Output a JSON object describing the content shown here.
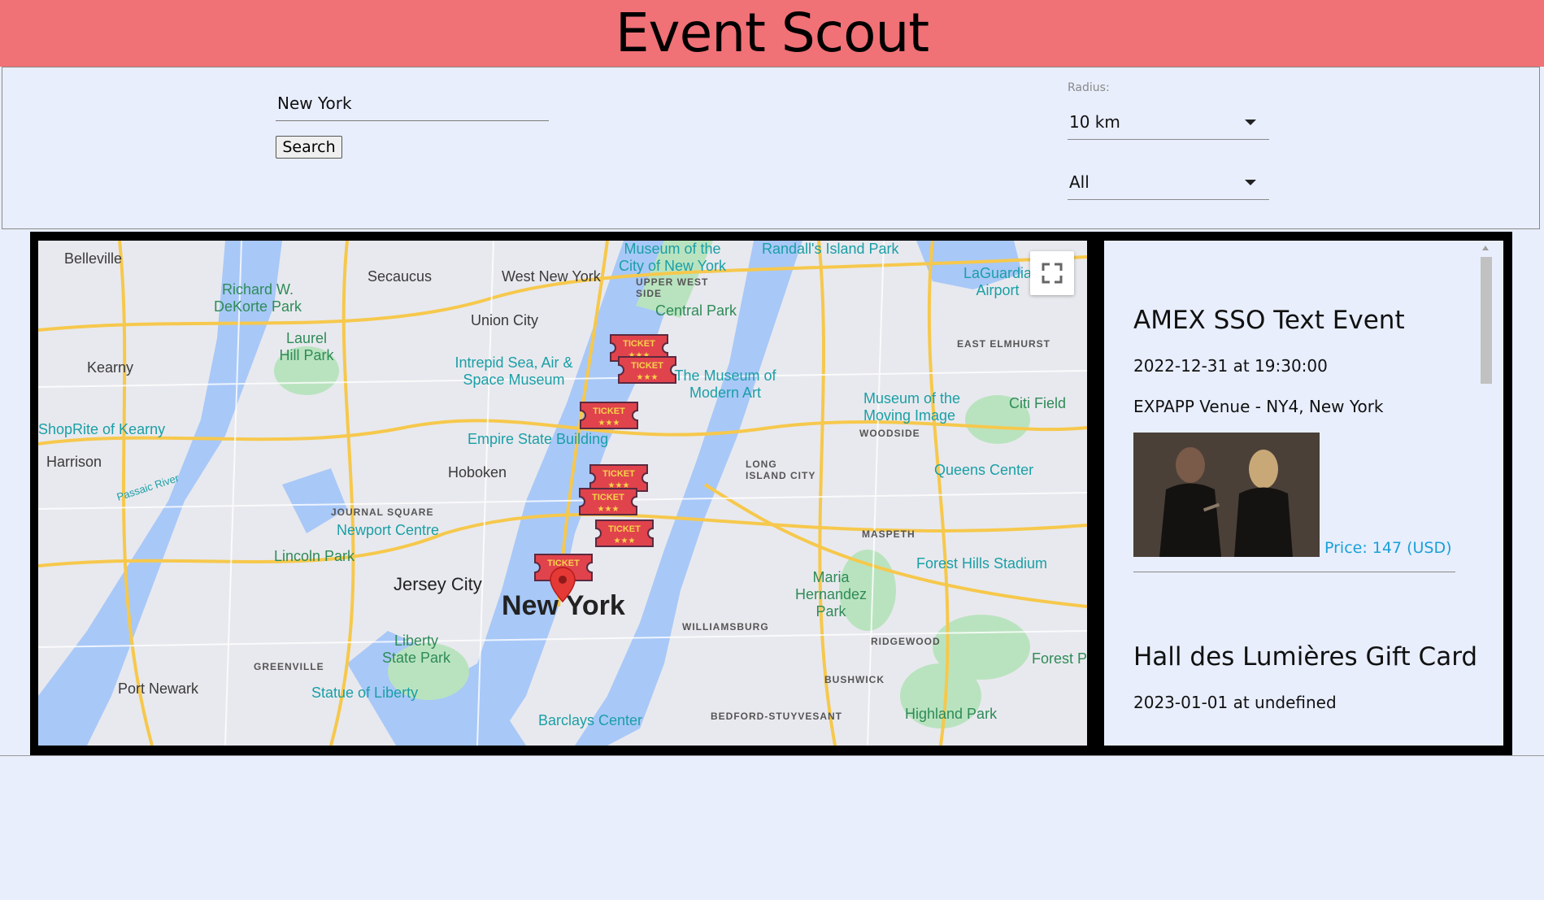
{
  "header": {
    "title": "Event Scout"
  },
  "search": {
    "location_value": "New York",
    "button_label": "Search",
    "radius_label": "Radius:",
    "radius_value": "10 km",
    "category_value": "All"
  },
  "map": {
    "labels": {
      "belleville": "Belleville",
      "secaucus": "Secaucus",
      "west_new_york": "West New York",
      "union_city": "Union City",
      "richard": "Richard W. DeKorte Park",
      "kearny": "Kearny",
      "laurel": "Laurel Hill Park",
      "harrison": "Harrison",
      "shoprite": "ShopRite of Kearny",
      "passaic": "Passaic River",
      "hoboken": "Hoboken",
      "journal_square": "JOURNAL SQUARE",
      "newport": "Newport Centre",
      "lincoln": "Lincoln Park",
      "jersey_city": "Jersey City",
      "new_york": "New York",
      "greenville": "GREENVILLE",
      "port_newark": "Port Newark",
      "liberty": "Liberty State Park",
      "statue": "Statue of Liberty",
      "intrepid": "Intrepid Sea, Air & Space Museum",
      "empire": "Empire State Building",
      "central_park": "Central Park",
      "upper_west": "UPPER WEST SIDE",
      "museum_city": "Museum of the City of New York",
      "randalls": "Randall's Island Park",
      "moma": "The Museum of Modern Art",
      "laguardia": "LaGuardia Airport",
      "east_elmhurst": "EAST ELMHURST",
      "moving_image": "Museum of the Moving Image",
      "woodside": "WOODSIDE",
      "citi_field": "Citi Field",
      "long_island_city": "LONG ISLAND CITY",
      "queens_center": "Queens Center",
      "maspeth": "MASPETH",
      "forest_hills": "Forest Hills Stadium",
      "maria": "Maria Hernandez Park",
      "ridgewood": "RIDGEWOOD",
      "williamsburg": "WILLIAMSBURG",
      "bushwick": "BUSHWICK",
      "bedford": "BEDFORD-STUYVESANT",
      "highland": "Highland Park",
      "barclays": "Barclays Center",
      "forest_park": "Forest P",
      "woodside_w": "WOODSIDE",
      "ticket": "TICKET"
    }
  },
  "events": [
    {
      "title": "AMEX SSO Text Event",
      "datetime": "2022-12-31 at 19:30:00",
      "venue": "EXPAPP Venue - NY4, New York",
      "price": "Price: 147 (USD)"
    },
    {
      "title": "Hall des Lumières Gift Card",
      "datetime": "2023-01-01 at undefined"
    }
  ]
}
